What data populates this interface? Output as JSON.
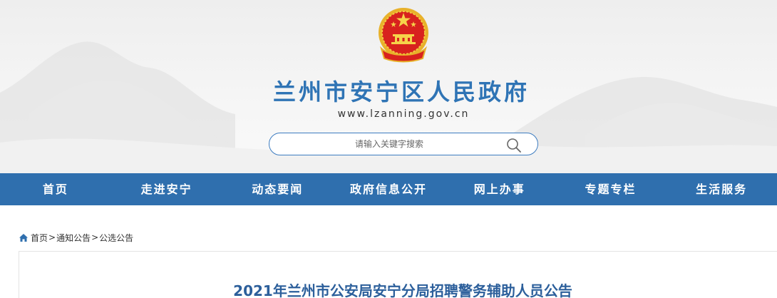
{
  "header": {
    "site_title": "兰州市安宁区人民政府",
    "site_url": "www.lzanning.gov.cn",
    "emblem_icon": "national-emblem-icon"
  },
  "search": {
    "placeholder": "请输入关键字搜索",
    "icon": "search-icon"
  },
  "nav": {
    "items": [
      "首页",
      "走进安宁",
      "动态要闻",
      "政府信息公开",
      "网上办事",
      "专题专栏",
      "生活服务"
    ]
  },
  "breadcrumb": {
    "icon": "home-icon",
    "items": [
      "首页",
      "通知公告",
      "公选公告"
    ],
    "separator": ">"
  },
  "article": {
    "title": "2021年兰州市公安局安宁分局招聘警务辅助人员公告"
  },
  "colors": {
    "nav_bg": "#2f6fae",
    "title_blue": "#2f74b5",
    "article_title": "#2c5f9b",
    "search_border": "#3d7cc0"
  }
}
